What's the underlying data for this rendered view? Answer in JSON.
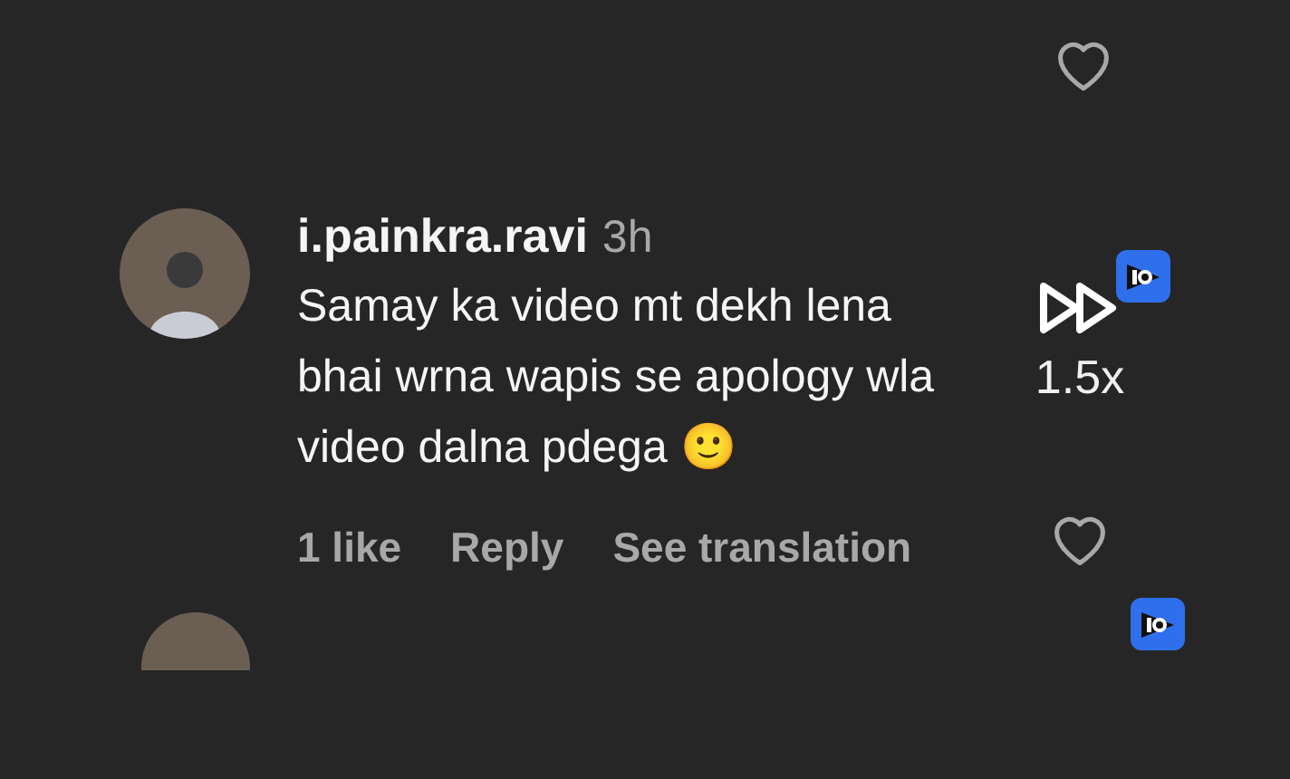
{
  "top_comment": {
    "liked": false
  },
  "comment": {
    "username": "i.painkra.ravi",
    "time": "3h",
    "text": "Samay ka video mt dekh lena bhai wrna wapis se apology wla video dalna pdega 🙂",
    "likes": "1 like",
    "reply": "Reply",
    "translate": "See translation",
    "liked": false
  },
  "speed_control": {
    "label": "1.5x"
  },
  "next_comment": {
    "visible": true
  }
}
